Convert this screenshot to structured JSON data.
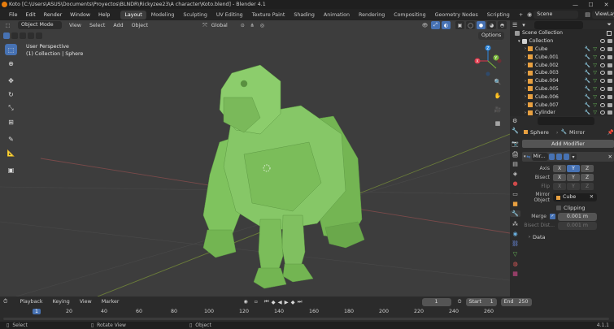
{
  "window": {
    "title": "Koto [C:\\Users\\ASUS\\Documents\\Proyectos\\BLNDR\\Rickyzee23\\A character\\Koto.blend] - Blender 4.1",
    "minimize": "—",
    "maximize": "☐",
    "close": "✕"
  },
  "menu": [
    "File",
    "Edit",
    "Render",
    "Window",
    "Help"
  ],
  "workspaces": [
    "Layout",
    "Modeling",
    "Sculpting",
    "UV Editing",
    "Texture Paint",
    "Shading",
    "Animation",
    "Rendering",
    "Compositing",
    "Geometry Nodes",
    "Scripting"
  ],
  "active_workspace": "Layout",
  "add_workspace": "+",
  "scene": "Scene",
  "view_layer": "ViewLayer",
  "viewport": {
    "mode": "Object Mode",
    "menus": [
      "View",
      "Select",
      "Add",
      "Object"
    ],
    "transform": "Global",
    "options": "Options",
    "perspective": "User Perspective",
    "collection_info": "(1) Collection | Sphere"
  },
  "outliner": {
    "search_placeholder": "",
    "root": "Scene Collection",
    "collection": "Collection",
    "items": [
      "Cube",
      "Cube.001",
      "Cube.002",
      "Cube.003",
      "Cube.004",
      "Cube.005",
      "Cube.006",
      "Cube.007",
      "Cylinder"
    ]
  },
  "properties": {
    "breadcrumb_object": "Sphere",
    "breadcrumb_modifier": "Mirror",
    "add_modifier": "Add Modifier",
    "modifier_name": "Mir...",
    "axis_label": "Axis",
    "bisect_label": "Bisect",
    "flip_label": "Flip",
    "axes": [
      "X",
      "Y",
      "Z"
    ],
    "mirror_object_label": "Mirror Object",
    "mirror_object": "Cube",
    "clipping_label": "Clipping",
    "merge_label": "Merge",
    "merge_value": "0.001 m",
    "bisect_dist_label": "Bisect Dist...",
    "bisect_dist_value": "0.001 m",
    "data_label": "Data"
  },
  "timeline": {
    "menus": [
      "Playback",
      "Keying",
      "View",
      "Marker"
    ],
    "current_frame": "1",
    "start_label": "Start",
    "start": "1",
    "end_label": "End",
    "end": "250",
    "ticks": [
      "1",
      "20",
      "40",
      "60",
      "80",
      "100",
      "120",
      "140",
      "160",
      "180",
      "200",
      "220",
      "240",
      "260"
    ]
  },
  "status": {
    "select": "Select",
    "rotate": "Rotate View",
    "object": "Object",
    "version": "4.1.1"
  },
  "colors": {
    "accent": "#4772b3",
    "model": "#7bbd5a",
    "viewport_bg": "#3d3d3d"
  }
}
